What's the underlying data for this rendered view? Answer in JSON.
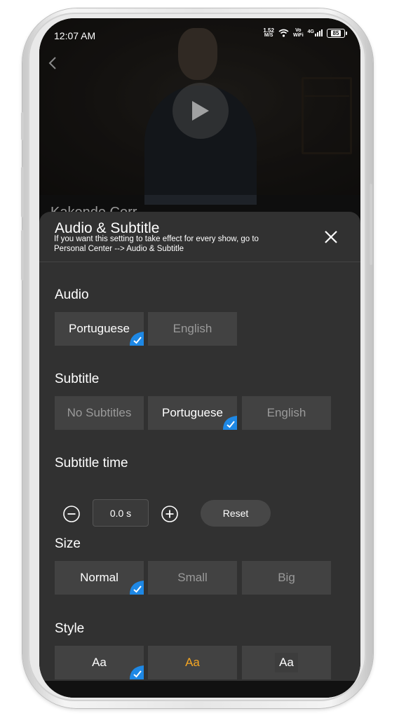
{
  "status_bar": {
    "time": "12:07 AM",
    "net_speed_value": "1.52",
    "net_speed_unit": "M/S",
    "vowifi_top": "Vo",
    "vowifi_bottom": "WiFi",
    "network": "4G",
    "battery": "85"
  },
  "video": {
    "behind_title": "Kakonde Corr..."
  },
  "panel": {
    "title": "Audio & Subtitle",
    "subtitle": "If you want this setting to take effect for every show, go to Personal Center --> Audio & Subtitle",
    "audio": {
      "label": "Audio",
      "options": [
        "Portuguese",
        "English"
      ],
      "selected": "Portuguese"
    },
    "subtitle_lang": {
      "label": "Subtitle",
      "options": [
        "No Subtitles",
        "Portuguese",
        "English"
      ],
      "selected": "Portuguese"
    },
    "subtitle_time": {
      "label": "Subtitle time",
      "value": "0.0 s",
      "reset_label": "Reset"
    },
    "size": {
      "label": "Size",
      "options": [
        "Normal",
        "Small",
        "Big"
      ],
      "selected": "Normal"
    },
    "style": {
      "label": "Style",
      "options": [
        "Aa",
        "Aa",
        "Aa"
      ],
      "selected_index": 0
    }
  },
  "colors": {
    "accent_check": "#1e88e5",
    "style_yellow": "#f5a623",
    "panel_bg": "#313131",
    "option_bg": "#424242"
  }
}
